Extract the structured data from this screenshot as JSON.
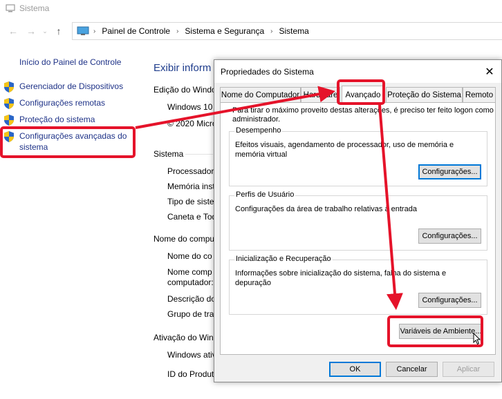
{
  "window": {
    "title": "Sistema"
  },
  "address": {
    "crumbs": [
      "Painel de Controle",
      "Sistema e Segurança",
      "Sistema"
    ]
  },
  "sidebar": {
    "home": "Início do Painel de Controle",
    "items": [
      {
        "label": "Gerenciador de Dispositivos"
      },
      {
        "label": "Configurações remotas"
      },
      {
        "label": "Proteção do sistema"
      },
      {
        "label_line1": "Configurações avançadas do",
        "label_line2": "sistema"
      }
    ]
  },
  "main": {
    "title": "Exibir inform",
    "edition_heading": "Edição do Windo",
    "edition_value": "Windows 10",
    "copyright": "© 2020 Micro",
    "system_heading": "Sistema",
    "processor": "Processador:",
    "memory": "Memória insta",
    "type": "Tipo de siste",
    "pen": "Caneta e Toq",
    "computer_heading": "Nome do compu",
    "computer_name": "Nome do co",
    "full_name_1": "Nome comp",
    "full_name_2": "computador:",
    "description": "Descrição do",
    "workgroup": "Grupo de tra",
    "activation_heading": "Ativação do Wind",
    "activation_value": "Windows ativ",
    "product_id": "ID do Produt"
  },
  "dialog": {
    "title": "Propriedades do Sistema",
    "close": "✕",
    "tabs": [
      "Nome do Computador",
      "Hardware",
      "Avançado",
      "Proteção do Sistema",
      "Remoto"
    ],
    "active_tab": "Avançado",
    "note_line1": "Para tirar o máximo proveito destas alterações, é preciso ter feito logon como",
    "note_line2": "administrador.",
    "performance": {
      "title": "Desempenho",
      "text_line1": "Efeitos visuais, agendamento de processador, uso de memória e",
      "text_line2": "memória virtual",
      "button": "Configurações..."
    },
    "profiles": {
      "title": "Perfis de Usuário",
      "text": "Configurações da área de trabalho relativas à entrada",
      "button": "Configurações..."
    },
    "startup": {
      "title": "Inicialização e Recuperação",
      "text_line1": "Informações sobre inicialização do sistema, falha do sistema e",
      "text_line2": "depuração",
      "button": "Configurações..."
    },
    "env_button": "Variáveis de Ambiente...",
    "ok": "OK",
    "cancel": "Cancelar",
    "apply": "Aplicar"
  },
  "colors": {
    "annotation": "#e5132a",
    "link": "#1e3287",
    "accent": "#0078d7"
  }
}
